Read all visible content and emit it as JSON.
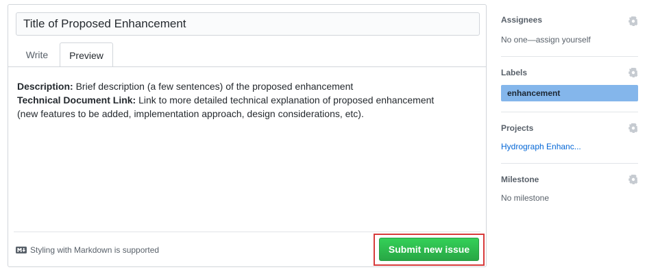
{
  "form": {
    "title_value": "Title of Proposed Enhancement",
    "tabs": [
      {
        "label": "Write"
      },
      {
        "label": "Preview"
      }
    ],
    "preview": {
      "line1_bold": "Description:",
      "line1_text": " Brief description (a few sentences) of the proposed enhancement",
      "line2_bold": "Technical Document Link:",
      "line2_text": " Link to more detailed technical explanation of proposed enhancement",
      "line3_text": "(new features to be added, implementation approach, design considerations, etc)."
    },
    "markdown_note": "Styling with Markdown is supported",
    "markdown_icon": "markdown-icon",
    "submit_label": "Submit new issue",
    "submit_color": "#28a745",
    "highlight_color": "#d73a3a"
  },
  "sidebar": {
    "assignees": {
      "heading": "Assignees",
      "value": "No one—assign yourself"
    },
    "labels": {
      "heading": "Labels",
      "pill": "enhancement",
      "pill_color": "#84b6eb"
    },
    "projects": {
      "heading": "Projects",
      "link": "Hydrograph Enhanc..."
    },
    "milestone": {
      "heading": "Milestone",
      "value": "No milestone"
    },
    "gear_icon": "gear-icon"
  }
}
